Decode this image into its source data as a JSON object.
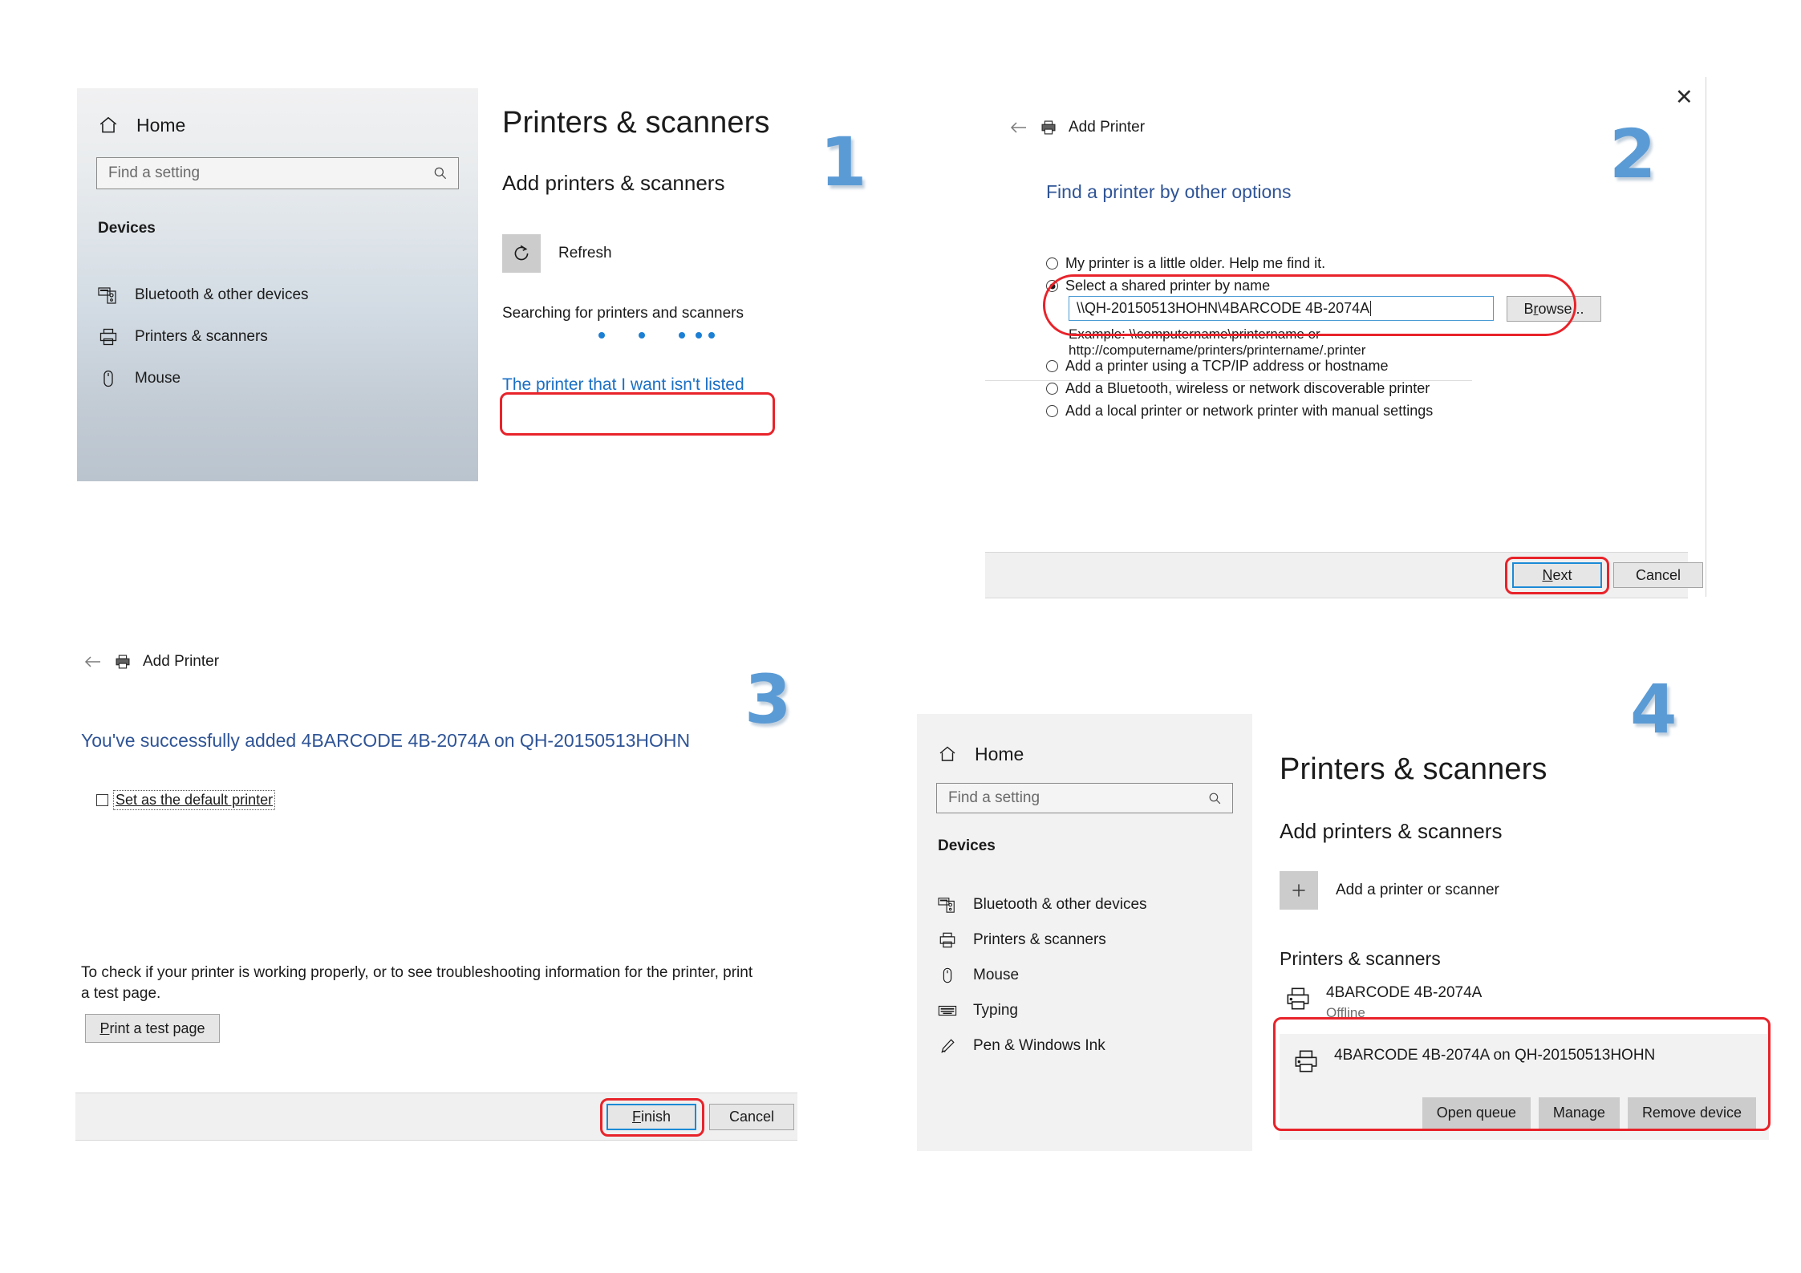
{
  "steps": {
    "one": "1",
    "two": "2",
    "three": "3",
    "four": "4"
  },
  "colors": {
    "step_blue": "#5B9BD5",
    "annotation_red": "#E8232A",
    "link_blue": "#1A6FC4",
    "heading_blue": "#2F5496",
    "accent_dot": "#1B7FD4"
  },
  "panel1": {
    "sidebar": {
      "home_label": "Home",
      "home_icon": "home-icon",
      "search_placeholder": "Find a setting",
      "search_icon": "search-icon",
      "group_heading": "Devices",
      "items": [
        {
          "label": "Bluetooth & other devices",
          "icon": "bluetooth-devices-icon"
        },
        {
          "label": "Printers & scanners",
          "icon": "printer-icon"
        },
        {
          "label": "Mouse",
          "icon": "mouse-icon"
        }
      ]
    },
    "content": {
      "page_title": "Printers & scanners",
      "section_title": "Add printers & scanners",
      "refresh_label": "Refresh",
      "refresh_icon": "refresh-icon",
      "searching_text": "Searching for printers and scanners",
      "not_listed_link": "The printer that I want isn't listed"
    }
  },
  "panel2": {
    "close_icon": "close-icon",
    "back_icon": "back-arrow-icon",
    "title_icon": "printer-icon",
    "title": "Add Printer",
    "headline": "Find a printer by other options",
    "options": [
      {
        "label": "My printer is a little older. Help me find it.",
        "selected": false
      },
      {
        "label": "Select a shared printer by name",
        "selected": true
      },
      {
        "label": "Add a printer using a TCP/IP address or hostname",
        "selected": false
      },
      {
        "label": "Add a Bluetooth, wireless or network discoverable printer",
        "selected": false
      },
      {
        "label": "Add a local printer or network printer with manual settings",
        "selected": false
      }
    ],
    "shared_printer_value": "\\\\QH-20150513HOHN\\4BARCODE 4B-2074A",
    "browse_label": "Browse...",
    "example_line1": "Example: \\\\computername\\printername or",
    "example_line2": "http://computername/printers/printername/.printer",
    "next_label": "Next",
    "cancel_label": "Cancel"
  },
  "panel3": {
    "back_icon": "back-arrow-icon",
    "title_icon": "printer-icon",
    "title": "Add Printer",
    "success_text": "You've successfully added 4BARCODE 4B-2074A on QH-20150513HOHN",
    "default_printer_label": "Set as the default printer",
    "default_printer_checked": false,
    "test_hint": "To check if your printer is working properly, or to see troubleshooting information for the printer, print a test page.",
    "print_test_label": "Print a test page",
    "finish_label": "Finish",
    "cancel_label": "Cancel"
  },
  "panel4": {
    "sidebar": {
      "home_label": "Home",
      "home_icon": "home-icon",
      "search_placeholder": "Find a setting",
      "search_icon": "search-icon",
      "group_heading": "Devices",
      "items": [
        {
          "label": "Bluetooth & other devices",
          "icon": "bluetooth-devices-icon"
        },
        {
          "label": "Printers & scanners",
          "icon": "printer-icon"
        },
        {
          "label": "Mouse",
          "icon": "mouse-icon"
        },
        {
          "label": "Typing",
          "icon": "keyboard-icon"
        },
        {
          "label": "Pen & Windows Ink",
          "icon": "pen-icon"
        }
      ]
    },
    "content": {
      "page_title": "Printers & scanners",
      "section_title": "Add printers & scanners",
      "add_printer_label": "Add a printer or scanner",
      "add_icon": "plus-icon",
      "list_title": "Printers & scanners",
      "devices": [
        {
          "name": "4BARCODE 4B-2074A",
          "status": "Offline",
          "icon": "printer-icon"
        },
        {
          "name": "4BARCODE 4B-2074A on QH-20150513HOHN",
          "status": "",
          "icon": "printer-icon"
        }
      ],
      "card_buttons": [
        "Open queue",
        "Manage",
        "Remove device"
      ]
    }
  }
}
